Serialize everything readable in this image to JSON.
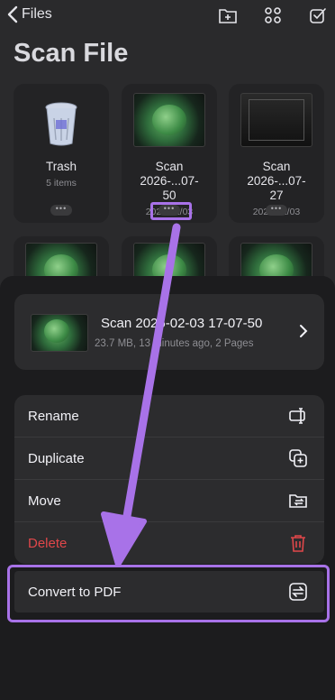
{
  "nav": {
    "back_label": "Files"
  },
  "page": {
    "title": "Scan File"
  },
  "grid": [
    {
      "name": "Trash",
      "meta": "5 items",
      "kind": "trash"
    },
    {
      "name": "Scan 2026-...07-50",
      "meta": "2026/02/03",
      "kind": "scan"
    },
    {
      "name": "Scan 2026-...07-27",
      "meta": "2026/02/03",
      "kind": "scan-dark"
    }
  ],
  "dots_label": "•••",
  "sheet": {
    "file": {
      "title": "Scan 2026-02-03 17-07-50",
      "subtitle": "23.7 MB, 13 minutes ago, 2 Pages"
    },
    "menu": [
      {
        "label": "Rename",
        "icon": "rename-icon"
      },
      {
        "label": "Duplicate",
        "icon": "duplicate-icon"
      },
      {
        "label": "Move",
        "icon": "move-folder-icon"
      },
      {
        "label": "Delete",
        "icon": "trash-icon"
      }
    ],
    "convert": {
      "label": "Convert to PDF",
      "icon": "convert-icon"
    }
  },
  "colors": {
    "accent_highlight": "#a872e8",
    "delete": "#e0474a",
    "background": "#1c1c1e"
  }
}
